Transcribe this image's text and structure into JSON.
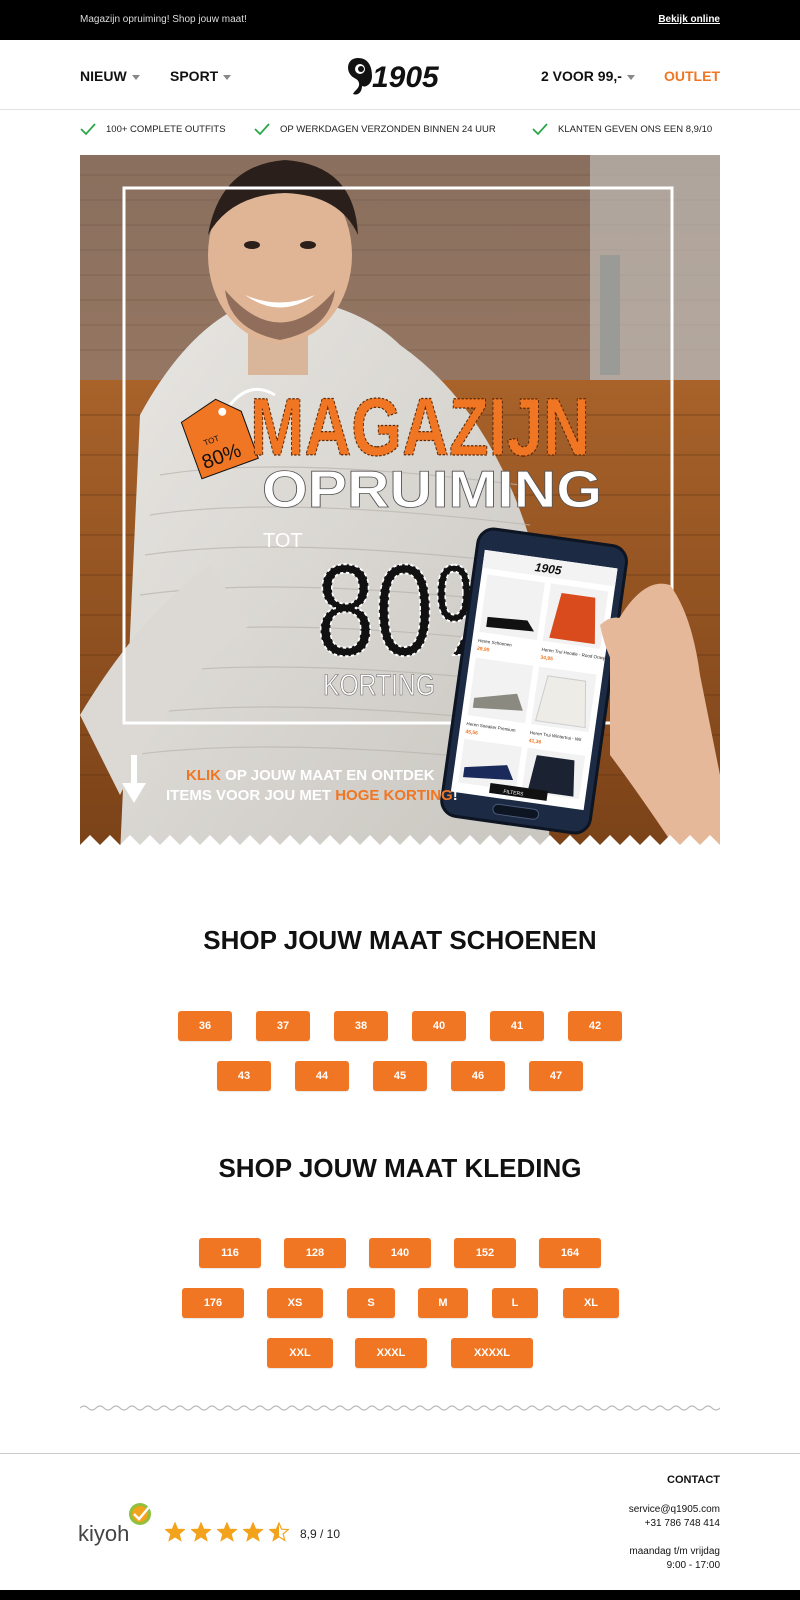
{
  "preheader": {
    "text": "Magazijn opruiming! Shop jouw maat!",
    "view_online": "Bekijk online"
  },
  "nav": {
    "items": [
      {
        "label": "NIEUW"
      },
      {
        "label": "SPORT"
      },
      {
        "label": "2 VOOR 99,-"
      },
      {
        "label": "OUTLET"
      }
    ],
    "logo_text": "1905",
    "accent_color": "#f07623"
  },
  "usps": [
    {
      "text": "100+ COMPLETE OUTFITS",
      "icon": "check-icon"
    },
    {
      "text": "OP WERKDAGEN VERZONDEN BINNEN 24 UUR",
      "icon": "check-icon"
    },
    {
      "text": "KLANTEN GEVEN ONS EEN 8,9/10",
      "icon": "check-icon"
    }
  ],
  "hero": {
    "title_line1": "MAGAZIJN",
    "title_line2": "OPRUIMING",
    "prefix": "TOT",
    "percent": "80%",
    "suffix": "KORTING",
    "tag_small": "TOT",
    "tag_percent": "80%",
    "cta_line1_accent": "KLIK",
    "cta_line1_rest": " OP JOUW MAAT EN ONTDEK",
    "cta_line2_start": "ITEMS VOOR JOU MET ",
    "cta_line2_accent": "HOGE KORTING",
    "cta_line2_end": "!",
    "phone_logo": "1905",
    "phone_items": [
      {
        "name": "Heren Schoenen",
        "price": "29,95"
      },
      {
        "name": "Heren Trui Hoodie - Rood Oranje",
        "price": "34,95"
      },
      {
        "name": "Heren Sneaker Premium",
        "price": "45,56"
      },
      {
        "name": "Heren Trui Wintertrui - Wit",
        "price": "41,36"
      }
    ],
    "phone_filter": "FILTERS"
  },
  "shoes": {
    "title": "SHOP JOUW MAAT SCHOENEN",
    "row1": [
      "36",
      "37",
      "38",
      "40",
      "41",
      "42"
    ],
    "row2": [
      "43",
      "44",
      "45",
      "46",
      "47"
    ]
  },
  "clothing": {
    "title": "SHOP JOUW MAAT KLEDING",
    "row1": [
      "116",
      "128",
      "140",
      "152",
      "164"
    ],
    "row2": [
      "176",
      "XS",
      "S",
      "M",
      "L",
      "XL"
    ],
    "row3": [
      "XXL",
      "XXXL",
      "XXXXL"
    ]
  },
  "footer": {
    "kiyoh": "kiyoh",
    "rating": "8,9 / 10",
    "stars_value": 4.5,
    "contact_title": "CONTACT",
    "email": "service@q1905.com",
    "phone": "+31 786 748 414",
    "hours_days": "maandag t/m vrijdag",
    "hours_time": "9:00 - 17:00"
  }
}
